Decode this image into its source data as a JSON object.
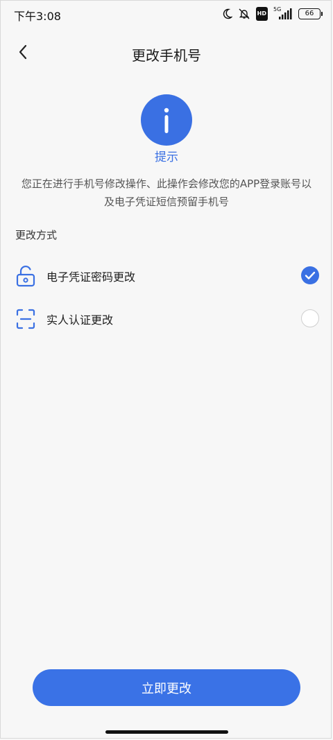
{
  "status_bar": {
    "time": "下午3:08",
    "network": "5G",
    "hd_label": "HD",
    "battery": "66"
  },
  "nav": {
    "title": "更改手机号",
    "back_icon": "chevron-left-icon"
  },
  "info": {
    "icon": "info-icon",
    "title": "提示",
    "description": "您正在进行手机号修改操作、此操作会修改您的APP登录账号以及电子凭证短信预留手机号"
  },
  "methods": {
    "section_label": "更改方式",
    "options": [
      {
        "label": "电子凭证密码更改",
        "icon": "unlock-icon",
        "selected": true
      },
      {
        "label": "实人认证更改",
        "icon": "face-scan-icon",
        "selected": false
      }
    ]
  },
  "actions": {
    "submit_label": "立即更改"
  },
  "colors": {
    "accent": "#3a70e3",
    "background": "#f7f7f7"
  }
}
